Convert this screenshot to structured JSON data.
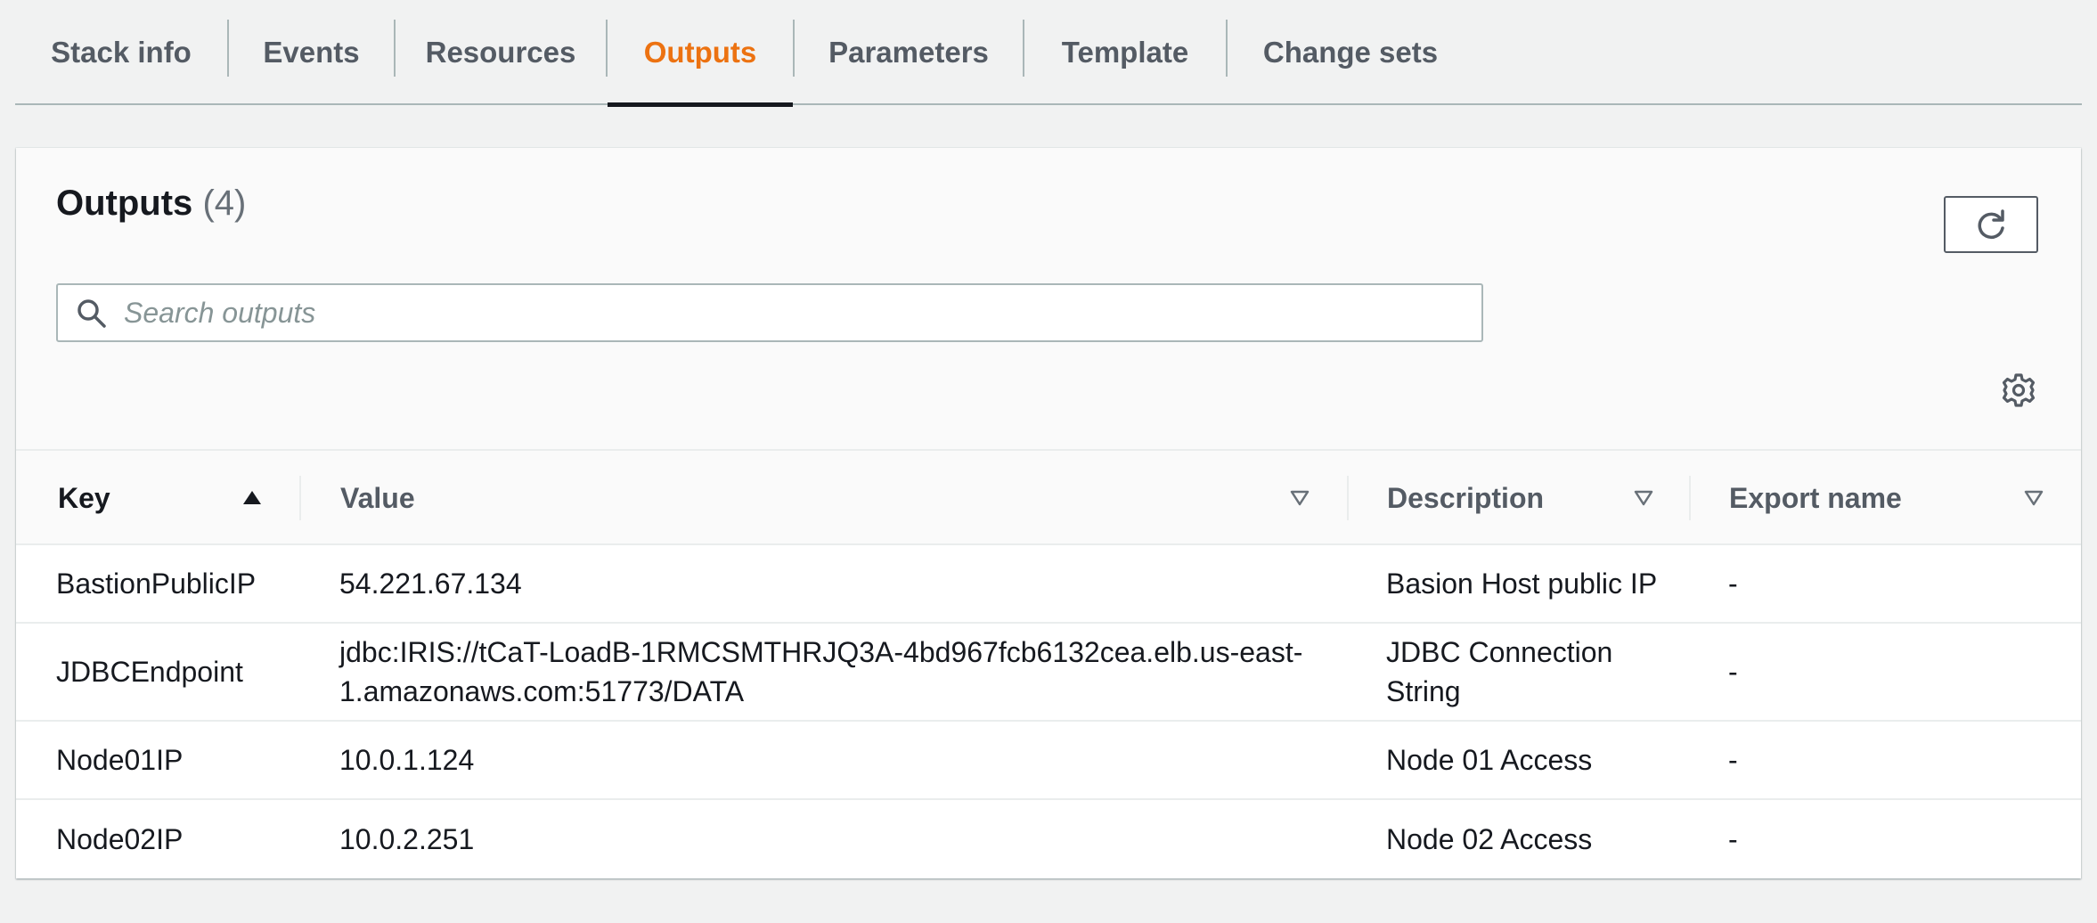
{
  "tabs": [
    {
      "label": "Stack info"
    },
    {
      "label": "Events"
    },
    {
      "label": "Resources"
    },
    {
      "label": "Outputs",
      "active": true
    },
    {
      "label": "Parameters"
    },
    {
      "label": "Template"
    },
    {
      "label": "Change sets"
    }
  ],
  "panel": {
    "title": "Outputs",
    "count": "(4)",
    "refresh_icon": "refresh-icon",
    "settings_icon": "gear-icon"
  },
  "search": {
    "placeholder": "Search outputs",
    "value": ""
  },
  "table": {
    "columns": [
      {
        "label": "Key",
        "sort": "ascending"
      },
      {
        "label": "Value",
        "sort": "none"
      },
      {
        "label": "Description",
        "sort": "none"
      },
      {
        "label": "Export name",
        "sort": "none"
      }
    ],
    "rows": [
      {
        "key": "BastionPublicIP",
        "value": "54.221.67.134",
        "description": "Basion Host public IP",
        "export": "-"
      },
      {
        "key": "JDBCEndpoint",
        "value": "jdbc:IRIS://tCaT-LoadB-1RMCSMTHRJQ3A-4bd967fcb6132cea.elb.us-east-1.amazonaws.com:51773/DATA",
        "description": "JDBC Connection String",
        "export": "-"
      },
      {
        "key": "Node01IP",
        "value": "10.0.1.124",
        "description": "Node 01 Access",
        "export": "-"
      },
      {
        "key": "Node02IP",
        "value": "10.0.2.251",
        "description": "Node 02 Access",
        "export": "-"
      }
    ]
  },
  "colors": {
    "accent": "#ec7211",
    "text": "#16191f",
    "muted": "#545b64",
    "background": "#f1f2f2"
  }
}
